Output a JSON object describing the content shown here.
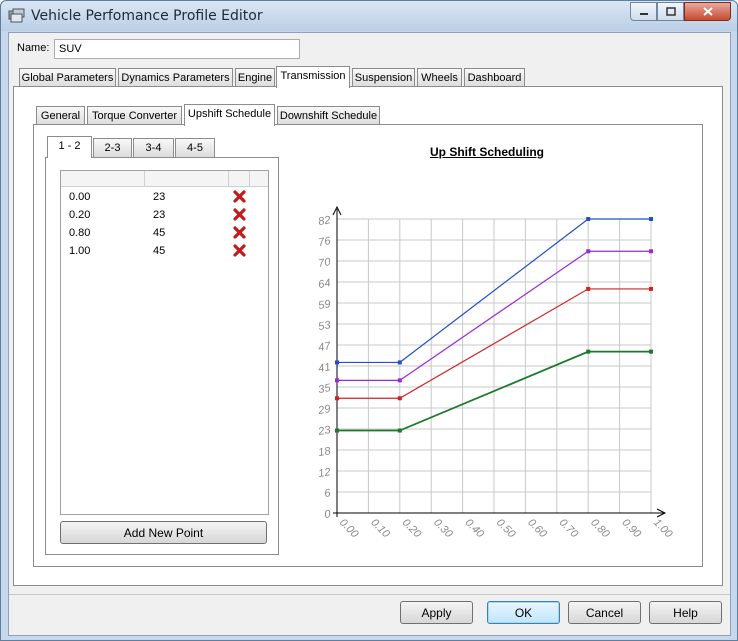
{
  "window": {
    "title": "Vehicle Perfomance Profile Editor",
    "icon": "vehicle-profile-icon",
    "controls": [
      "minimize-icon",
      "maximize-icon",
      "close-icon"
    ]
  },
  "name": {
    "label": "Name:",
    "value": "SUV"
  },
  "main_tabs": [
    {
      "label": "Global Parameters",
      "active": false
    },
    {
      "label": "Dynamics Parameters",
      "active": false
    },
    {
      "label": "Engine",
      "active": false
    },
    {
      "label": "Transmission",
      "active": true
    },
    {
      "label": "Suspension",
      "active": false
    },
    {
      "label": "Wheels",
      "active": false
    },
    {
      "label": "Dashboard",
      "active": false
    }
  ],
  "sub_tabs": [
    {
      "label": "General",
      "active": false
    },
    {
      "label": "Torque Converter",
      "active": false
    },
    {
      "label": "Upshift Schedule",
      "active": true
    },
    {
      "label": "Downshift Schedule",
      "active": false
    }
  ],
  "gear_tabs": [
    {
      "label": "1 - 2",
      "active": true
    },
    {
      "label": "2-3",
      "active": false
    },
    {
      "label": "3-4",
      "active": false
    },
    {
      "label": "4-5",
      "active": false
    }
  ],
  "points": [
    {
      "x": "0.00",
      "y": "23"
    },
    {
      "x": "0.20",
      "y": "23"
    },
    {
      "x": "0.80",
      "y": "45"
    },
    {
      "x": "1.00",
      "y": "45"
    }
  ],
  "add_point_label": "Add New Point",
  "chart_data": {
    "type": "line",
    "title": "Up Shift Scheduling",
    "xlabel": "",
    "ylabel": "",
    "xlim": [
      0,
      1.0
    ],
    "ylim": [
      0,
      82
    ],
    "x_ticks": [
      "0.00",
      "0.10",
      "0.20",
      "0.30",
      "0.40",
      "0.50",
      "0.60",
      "0.70",
      "0.80",
      "0.90",
      "1.00"
    ],
    "y_ticks": [
      "0",
      "6",
      "12",
      "18",
      "23",
      "29",
      "35",
      "41",
      "47",
      "53",
      "59",
      "64",
      "70",
      "76",
      "82"
    ],
    "y_tick_values": [
      0,
      5.857,
      11.714,
      17.571,
      23.429,
      29.286,
      35.143,
      41,
      46.857,
      52.714,
      58.571,
      64.429,
      70.286,
      76.143,
      82
    ],
    "grid": true,
    "series": [
      {
        "x": [
          0,
          0.2,
          0.8,
          1.0
        ],
        "values": [
          23,
          23,
          45,
          45
        ],
        "color": "#1a7a2a"
      },
      {
        "x": [
          0,
          0.2,
          0.8,
          1.0
        ],
        "values": [
          32,
          32,
          62.5,
          62.5
        ],
        "color": "#d42020"
      },
      {
        "x": [
          0,
          0.2,
          0.8,
          1.0
        ],
        "values": [
          37,
          37,
          73,
          73
        ],
        "color": "#9a2bd4"
      },
      {
        "x": [
          0,
          0.2,
          0.8,
          1.0
        ],
        "values": [
          42,
          42,
          82,
          82
        ],
        "color": "#2050c8"
      }
    ]
  },
  "buttons": {
    "apply": "Apply",
    "ok": "OK",
    "cancel": "Cancel",
    "help": "Help"
  }
}
